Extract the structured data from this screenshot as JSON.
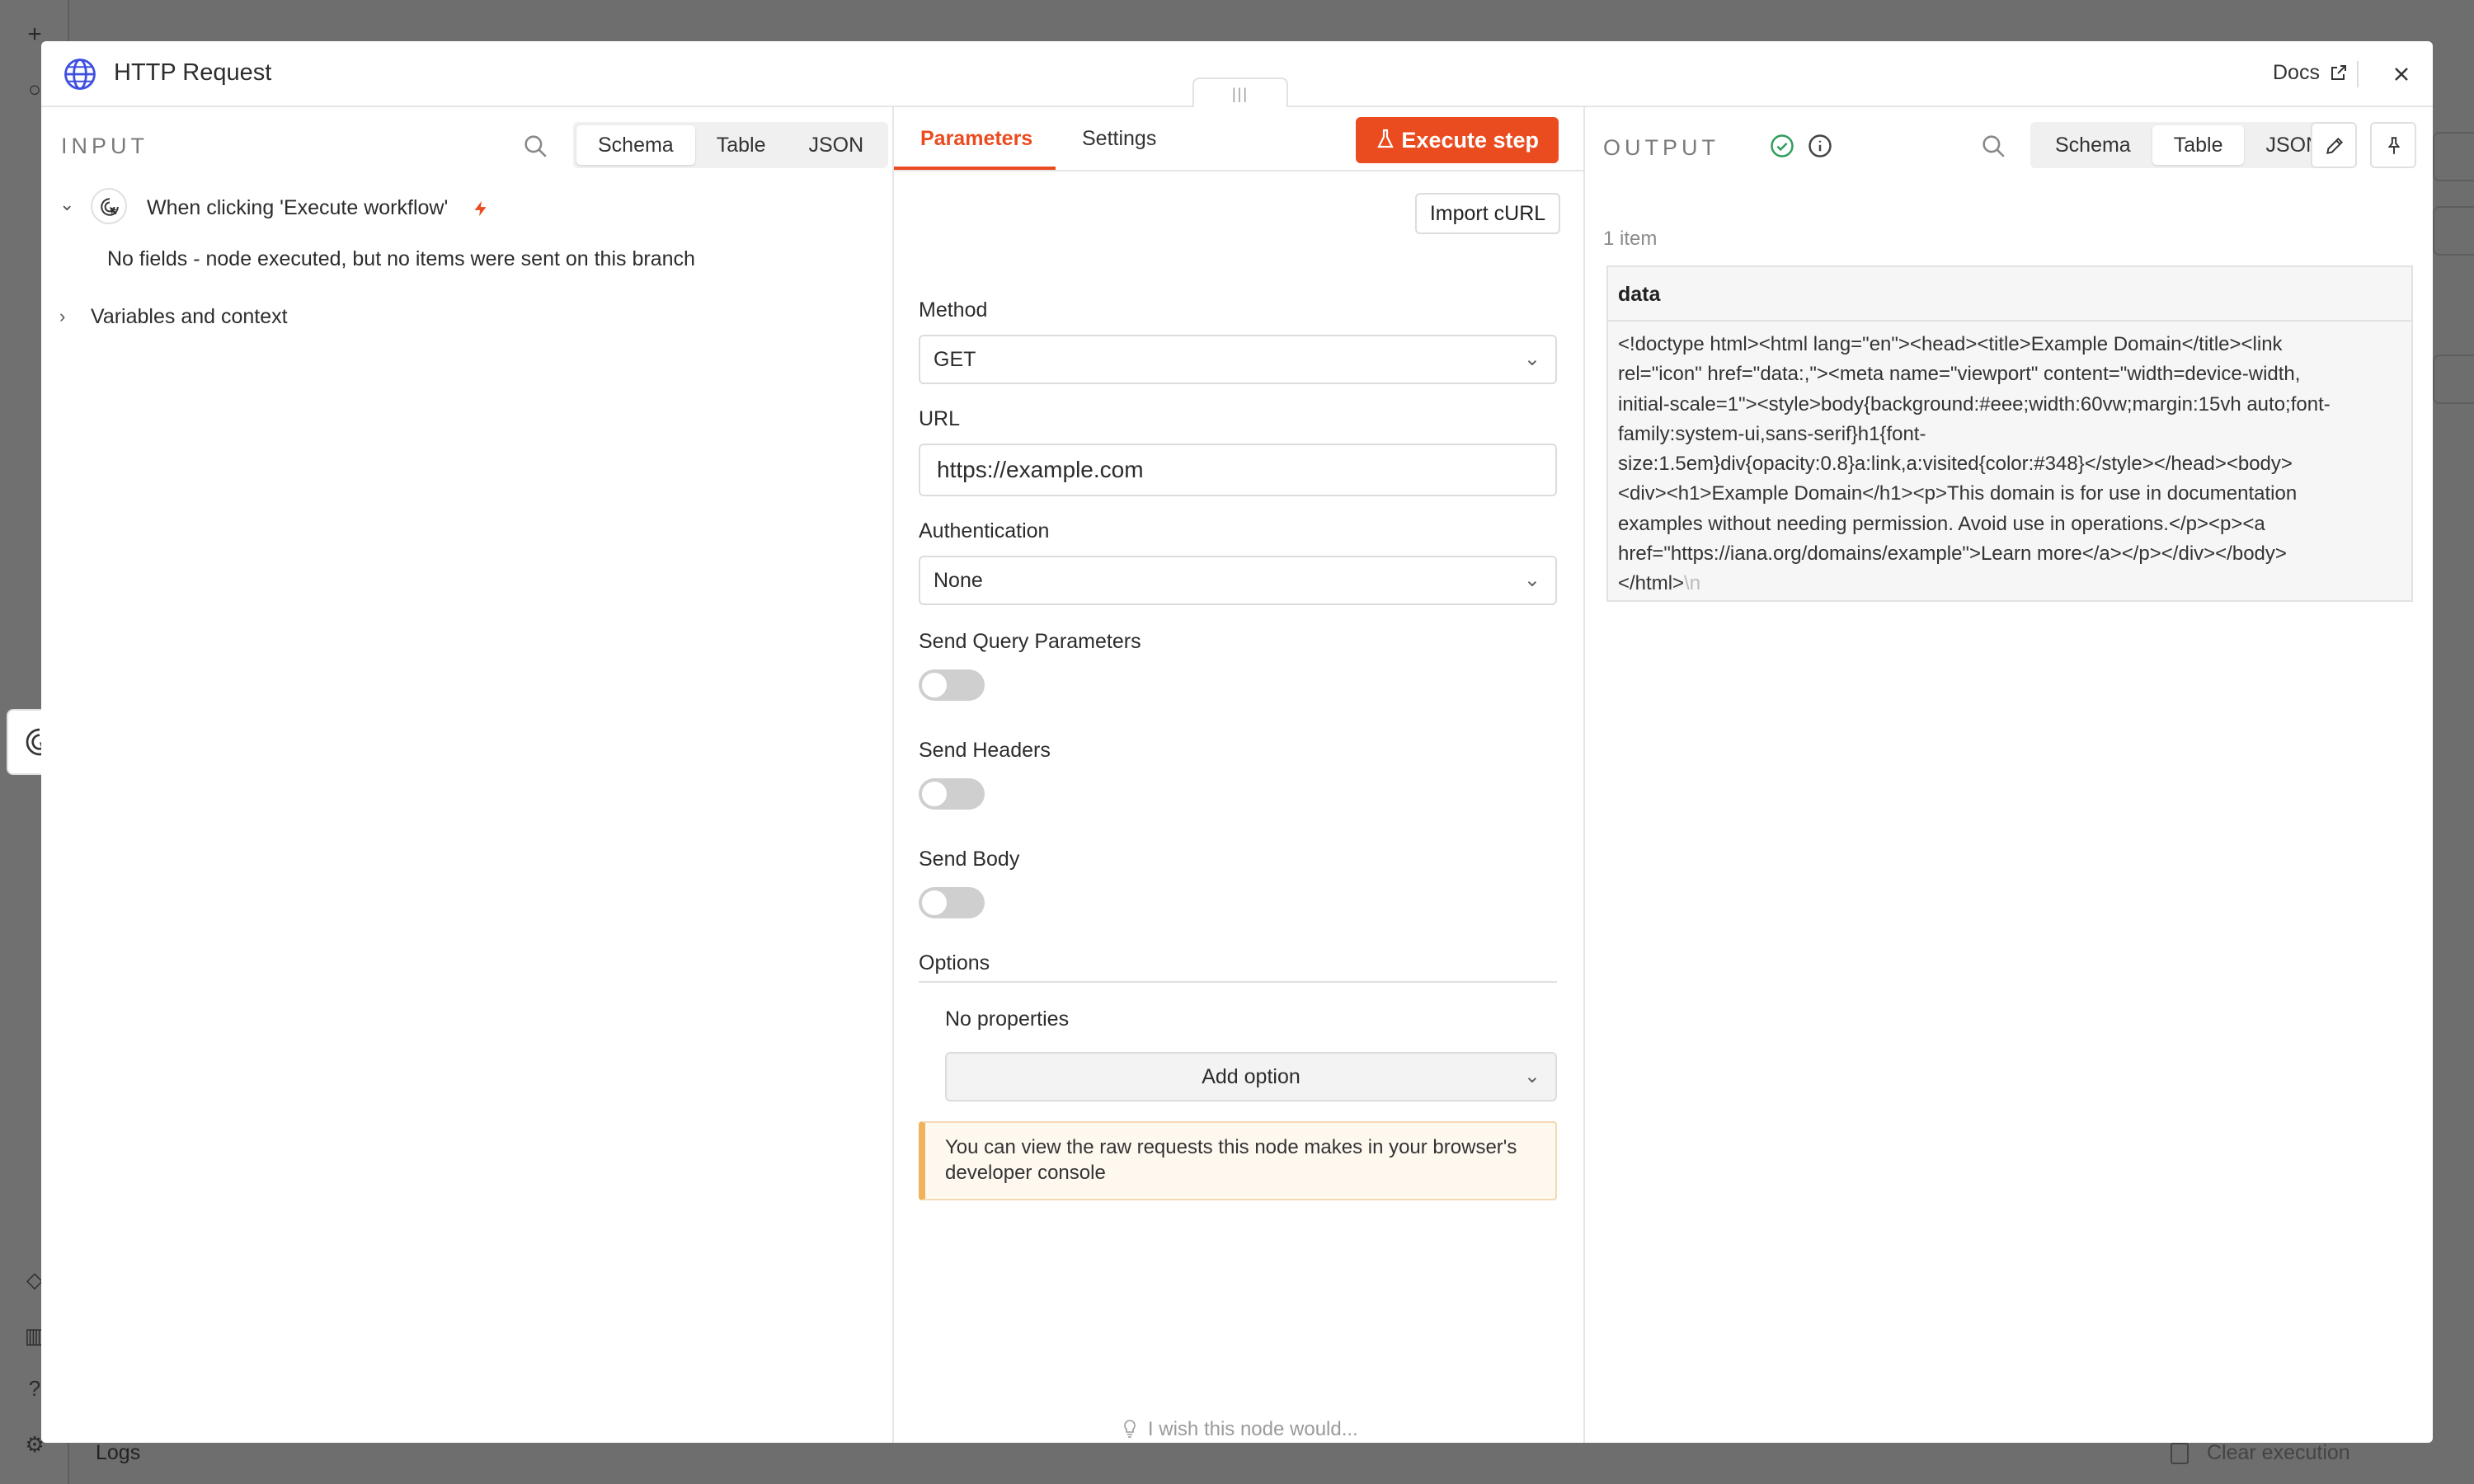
{
  "background": {
    "logs_label": "Logs",
    "clear_execution_label": "Clear execution"
  },
  "modal": {
    "title": "HTTP Request",
    "docs_label": "Docs",
    "handle_label": "|||"
  },
  "input_panel": {
    "label": "INPUT",
    "view_tabs": [
      "Schema",
      "Table",
      "JSON"
    ],
    "active_view": "Schema",
    "trigger_node": {
      "name": "When clicking 'Execute workflow'",
      "message": "No fields - node executed, but no items were sent on this branch"
    },
    "variables_label": "Variables and context"
  },
  "params_panel": {
    "tabs": [
      "Parameters",
      "Settings"
    ],
    "active_tab": "Parameters",
    "execute_label": "Execute step",
    "import_curl_label": "Import cURL",
    "method": {
      "label": "Method",
      "value": "GET"
    },
    "url": {
      "label": "URL",
      "value": "https://example.com"
    },
    "authentication": {
      "label": "Authentication",
      "value": "None"
    },
    "send_query": {
      "label": "Send Query Parameters",
      "enabled": false
    },
    "send_headers": {
      "label": "Send Headers",
      "enabled": false
    },
    "send_body": {
      "label": "Send Body",
      "enabled": false
    },
    "options": {
      "label": "Options",
      "empty_text": "No properties",
      "add_label": "Add option"
    },
    "notice": "You can view the raw requests this node makes in your browser's developer console",
    "wish_label": "I wish this node would..."
  },
  "output_panel": {
    "label": "OUTPUT",
    "view_tabs": [
      "Schema",
      "Table",
      "JSON"
    ],
    "active_view": "Table",
    "item_count": "1 item",
    "table": {
      "column": "data",
      "cell_lines": [
        "<!doctype html><html lang=\"en\"><head><title>Example Domain</title><link",
        "rel=\"icon\" href=\"data:,\"><meta name=\"viewport\" content=\"width=device-width,",
        "initial-scale=1\"><style>body{background:#eee;width:60vw;margin:15vh auto;font-",
        "family:system-ui,sans-serif}h1{font-",
        "size:1.5em}div{opacity:0.8}a:link,a:visited{color:#348}</style></head><body>",
        "<div><h1>Example Domain</h1><p>This domain is for use in documentation",
        "examples without needing permission. Avoid use in operations.</p><p><a",
        "href=\"https://iana.org/domains/example\">Learn more</a></p></div></body>",
        "</html>"
      ],
      "newline_marker": "\\n"
    }
  },
  "colors": {
    "accent": "#ea4b1f",
    "success": "#2e9e5b",
    "brand_icon": "#3d4ee0"
  }
}
